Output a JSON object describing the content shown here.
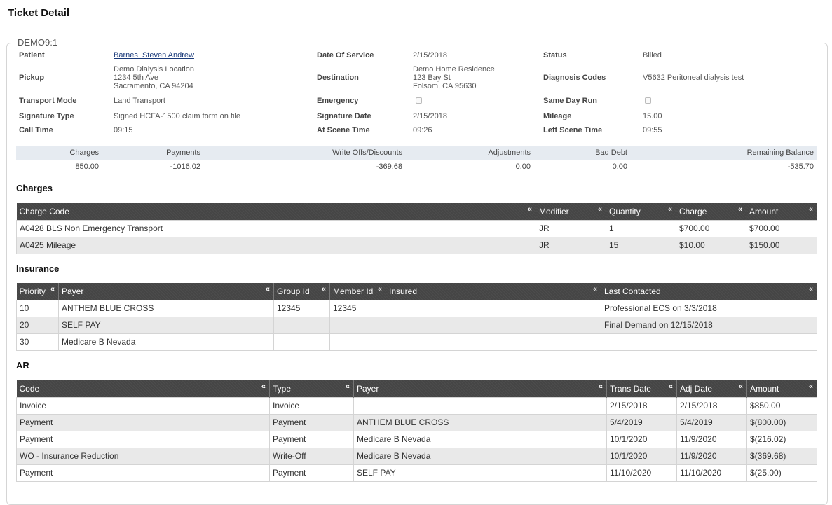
{
  "page": {
    "title": "Ticket Detail"
  },
  "ticket": {
    "id": "DEMO9:1",
    "patient_label": "Patient",
    "patient_value": "Barnes, Steven Andrew",
    "date_of_service_label": "Date Of Service",
    "date_of_service_value": "2/15/2018",
    "status_label": "Status",
    "status_value": "Billed",
    "pickup_label": "Pickup",
    "pickup_line1": "Demo Dialysis Location",
    "pickup_line2": "1234 5th Ave",
    "pickup_line3": "Sacramento, CA 94204",
    "destination_label": "Destination",
    "destination_line1": "Demo Home Residence",
    "destination_line2": "123 Bay St",
    "destination_line3": "Folsom, CA 95630",
    "diagnosis_label": "Diagnosis Codes",
    "diagnosis_value": "V5632 Peritoneal dialysis test",
    "transport_mode_label": "Transport Mode",
    "transport_mode_value": "Land Transport",
    "emergency_label": "Emergency",
    "same_day_run_label": "Same Day Run",
    "signature_type_label": "Signature Type",
    "signature_type_value": "Signed HCFA-1500 claim form on file",
    "signature_date_label": "Signature Date",
    "signature_date_value": "2/15/2018",
    "mileage_label": "Mileage",
    "mileage_value": "15.00",
    "call_time_label": "Call Time",
    "call_time_value": "09:15",
    "at_scene_label": "At Scene Time",
    "at_scene_value": "09:26",
    "left_scene_label": "Left Scene Time",
    "left_scene_value": "09:55"
  },
  "summary": {
    "charges_label": "Charges",
    "charges_value": "850.00",
    "payments_label": "Payments",
    "payments_value": "-1016.02",
    "writeoffs_label": "Write Offs/Discounts",
    "writeoffs_value": "-369.68",
    "adjustments_label": "Adjustments",
    "adjustments_value": "0.00",
    "bad_debt_label": "Bad Debt",
    "bad_debt_value": "0.00",
    "remaining_label": "Remaining Balance",
    "remaining_value": "-535.70"
  },
  "charges": {
    "title": "Charges",
    "columns": [
      "Charge Code",
      "Modifier",
      "Quantity",
      "Charge",
      "Amount"
    ],
    "rows": [
      [
        "A0428 BLS Non Emergency Transport",
        "JR",
        "1",
        "$700.00",
        "$700.00"
      ],
      [
        "A0425 Mileage",
        "JR",
        "15",
        "$10.00",
        "$150.00"
      ]
    ]
  },
  "insurance": {
    "title": "Insurance",
    "columns": [
      "Priority",
      "Payer",
      "Group Id",
      "Member Id",
      "Insured",
      "Last Contacted"
    ],
    "rows": [
      [
        "10",
        "ANTHEM BLUE CROSS",
        "12345",
        "12345",
        "",
        "Professional ECS on 3/3/2018"
      ],
      [
        "20",
        "SELF PAY",
        "",
        "",
        "",
        "Final Demand on 12/15/2018"
      ],
      [
        "30",
        "Medicare B Nevada",
        "",
        "",
        "",
        ""
      ]
    ]
  },
  "ar": {
    "title": "AR",
    "columns": [
      "Code",
      "Type",
      "Payer",
      "Trans Date",
      "Adj Date",
      "Amount"
    ],
    "rows": [
      [
        "Invoice",
        "Invoice",
        "",
        "2/15/2018",
        "2/15/2018",
        "$850.00"
      ],
      [
        "Payment",
        "Payment",
        "ANTHEM BLUE CROSS",
        "5/4/2019",
        "5/4/2019",
        "$(800.00)"
      ],
      [
        "Payment",
        "Payment",
        "Medicare B Nevada",
        "10/1/2020",
        "11/9/2020",
        "$(216.02)"
      ],
      [
        "WO - Insurance Reduction",
        "Write-Off",
        "Medicare B Nevada",
        "10/1/2020",
        "11/9/2020",
        "$(369.68)"
      ],
      [
        "Payment",
        "Payment",
        "SELF PAY",
        "11/10/2020",
        "11/10/2020",
        "$(25.00)"
      ]
    ]
  },
  "icons": {
    "collapse_glyph": "«"
  }
}
